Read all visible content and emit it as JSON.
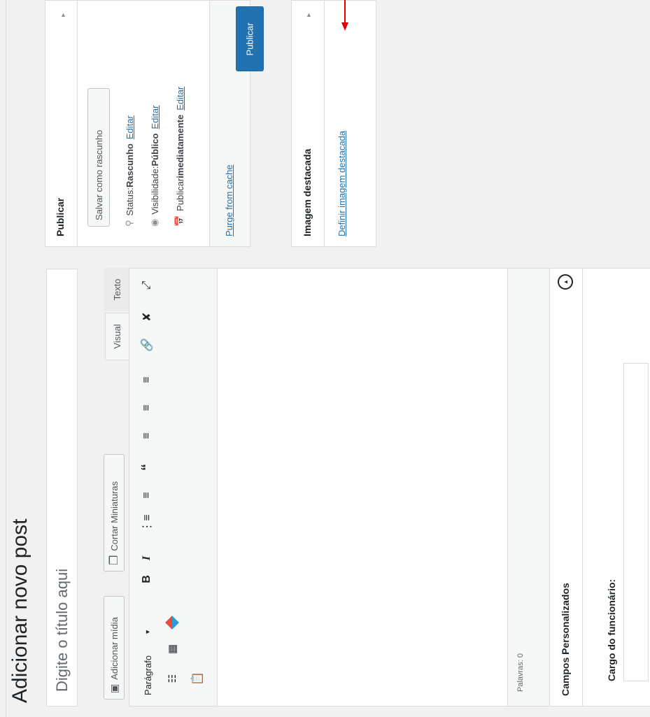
{
  "page": {
    "title": "Adicionar novo post"
  },
  "editor": {
    "title_placeholder": "Digite o título aqui",
    "add_media_label": "Adicionar mídia",
    "crop_thumbnails_label": "Cortar Miniaturas",
    "tab_visual": "Visual",
    "tab_text": "Texto",
    "format_select_value": "Parágrafo",
    "word_count": "Palavras: 0"
  },
  "publish_box": {
    "heading": "Publicar",
    "save_draft_label": "Salvar como rascunho",
    "status_label": "Status: ",
    "status_value": "Rascunho",
    "status_edit": "Editar",
    "visibility_label": "Visibilidade: ",
    "visibility_value": "Público",
    "visibility_edit": "Editar",
    "schedule_label": "Publicar ",
    "schedule_value": "imediatamente",
    "schedule_edit": "Editar",
    "purge_cache_label": "Purge from cache",
    "publish_button_label": "Publicar"
  },
  "featured_image_box": {
    "heading": "Imagem destacada",
    "set_link": "Definir imagem destacada"
  },
  "custom_fields_box": {
    "heading": "Campos Personalizados",
    "field_label": "Cargo do funcionário:",
    "field_value": ""
  },
  "colors": {
    "accent": "#2271b1",
    "publish_button": "#2271b1",
    "annotation_arrow": "#e00000"
  },
  "icons": [
    "key-icon",
    "eye-icon",
    "calendar-icon",
    "media-icon",
    "crop-icon",
    "bold-icon",
    "italic-icon",
    "bullet-list-icon",
    "numbered-list-icon",
    "blockquote-icon",
    "align-left-icon",
    "align-center-icon",
    "align-right-icon",
    "link-icon",
    "unlink-icon",
    "fullscreen-icon",
    "toolbar-toggle-icon",
    "table-icon",
    "colorful-plugin-icon",
    "paste-icon",
    "arrow-up-icon",
    "collapse-toggle-icon"
  ]
}
